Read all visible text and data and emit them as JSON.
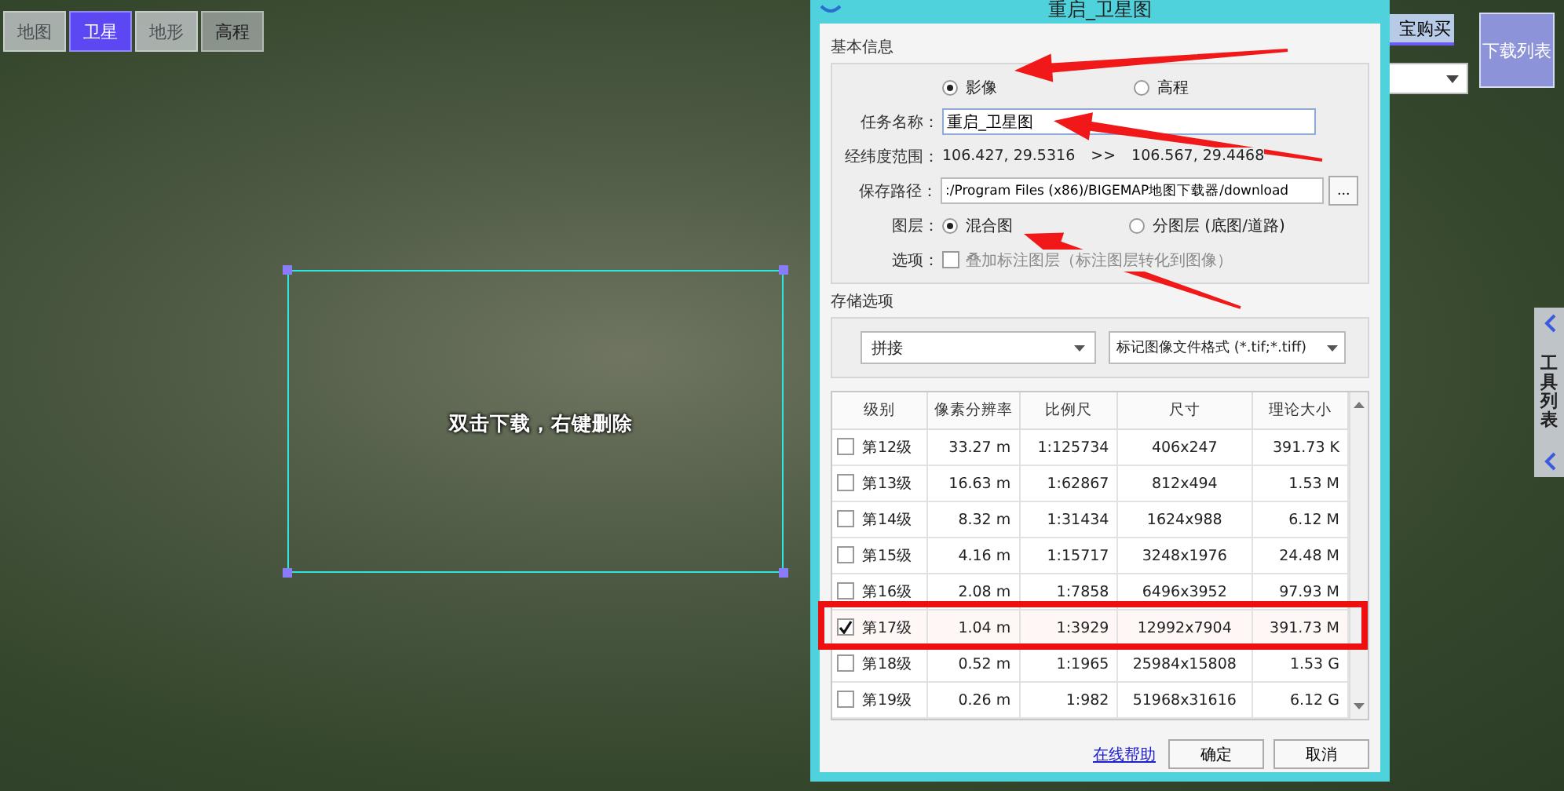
{
  "map": {
    "type_buttons": [
      {
        "label": "地图",
        "selected": false,
        "disabled": true
      },
      {
        "label": "卫星",
        "selected": true,
        "disabled": false
      },
      {
        "label": "地形",
        "selected": false,
        "disabled": true
      },
      {
        "label": "高程",
        "selected": false,
        "disabled": false
      }
    ],
    "selection_hint": "双击下载，右键删除",
    "buy_button": "宝购买",
    "download_list_button": "下载列表",
    "tools_tab": "工具列表"
  },
  "dialog": {
    "title": "重启_卫星图",
    "basic_section": "基本信息",
    "source_options": [
      {
        "label": "影像",
        "selected": true
      },
      {
        "label": "高程",
        "selected": false
      }
    ],
    "task_name_label": "任务名称：",
    "task_name": "重启_卫星图",
    "range_label": "经纬度范围：",
    "range_from": "106.427, 29.5316",
    "range_sep": ">>",
    "range_to": "106.567, 29.4468",
    "path_label": "保存路径：",
    "path": ":/Program Files (x86)/BIGEMAP地图下载器/download",
    "browse_button": "...",
    "layer_label": "图层：",
    "layer_options": [
      {
        "label": "混合图",
        "selected": true
      },
      {
        "label": "分图层 (底图/道路)",
        "selected": false
      }
    ],
    "options_label": "选项：",
    "overlay_option": {
      "label": "叠加标注图层（标注图层转化到图像）",
      "checked": false,
      "disabled": true
    },
    "storage_section": "存储选项",
    "mode_select": "拼接",
    "format_select": "标记图像文件格式 (*.tif;*.tiff)",
    "table": {
      "columns": [
        "级别",
        "像素分辨率",
        "比例尺",
        "尺寸",
        "理论大小"
      ],
      "rows": [
        {
          "level": "第12级",
          "resolution": "33.27 m",
          "scale": "1:125734",
          "size": "406x247",
          "file_size": "391.73 K",
          "checked": false,
          "highlighted": false
        },
        {
          "level": "第13级",
          "resolution": "16.63 m",
          "scale": "1:62867",
          "size": "812x494",
          "file_size": "1.53 M",
          "checked": false,
          "highlighted": false
        },
        {
          "level": "第14级",
          "resolution": "8.32 m",
          "scale": "1:31434",
          "size": "1624x988",
          "file_size": "6.12 M",
          "checked": false,
          "highlighted": false
        },
        {
          "level": "第15级",
          "resolution": "4.16 m",
          "scale": "1:15717",
          "size": "3248x1976",
          "file_size": "24.48 M",
          "checked": false,
          "highlighted": false
        },
        {
          "level": "第16级",
          "resolution": "2.08 m",
          "scale": "1:7858",
          "size": "6496x3952",
          "file_size": "97.93 M",
          "checked": false,
          "highlighted": false
        },
        {
          "level": "第17级",
          "resolution": "1.04 m",
          "scale": "1:3929",
          "size": "12992x7904",
          "file_size": "391.73 M",
          "checked": true,
          "highlighted": true
        },
        {
          "level": "第18级",
          "resolution": "0.52 m",
          "scale": "1:1965",
          "size": "25984x15808",
          "file_size": "1.53 G",
          "checked": false,
          "highlighted": false
        },
        {
          "level": "第19级",
          "resolution": "0.26 m",
          "scale": "1:982",
          "size": "51968x31616",
          "file_size": "6.12 G",
          "checked": false,
          "highlighted": false
        }
      ]
    },
    "help_link": "在线帮助",
    "ok_button": "确定",
    "cancel_button": "取消"
  }
}
